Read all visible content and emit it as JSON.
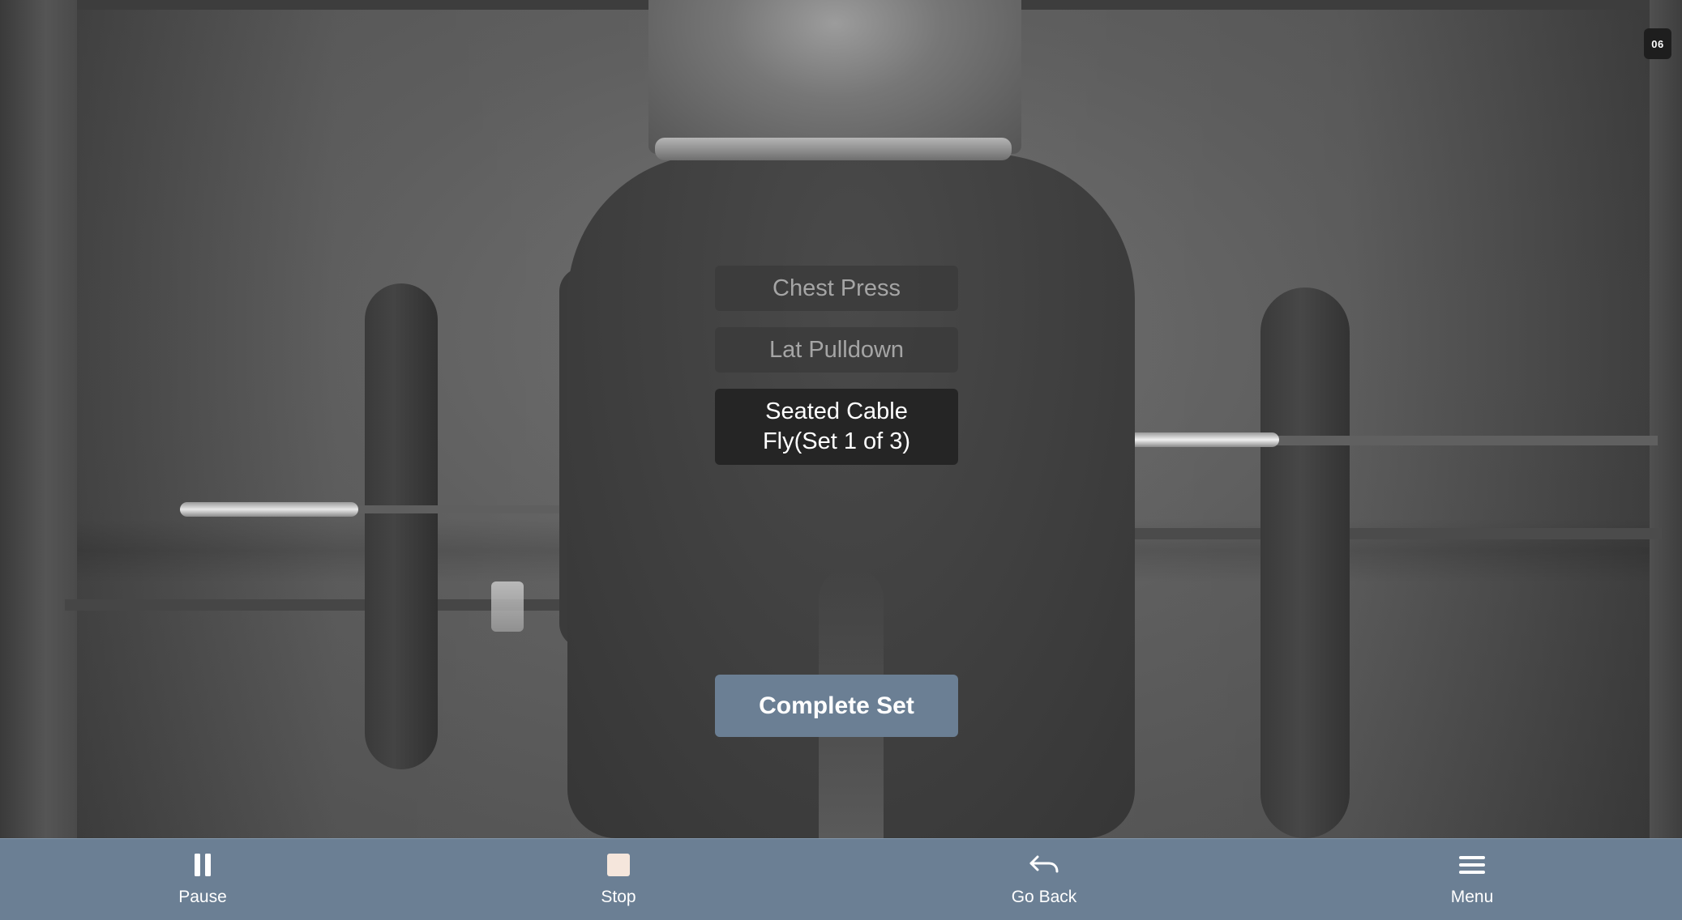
{
  "colors": {
    "accent": "#6b7f94",
    "current_item_bg": "#252525",
    "upcoming_item_bg": "#3a3a3a",
    "upcoming_text": "#a5a5a5",
    "stop_icon": "#f5e6dc"
  },
  "corner_badge": {
    "text": "06"
  },
  "exercises": {
    "items": [
      {
        "label": "Chest Press",
        "state": "upcoming"
      },
      {
        "label": "Lat Pulldown",
        "state": "upcoming"
      },
      {
        "label": "Seated Cable Fly(Set 1 of 3)",
        "state": "current"
      }
    ]
  },
  "actions": {
    "complete_set_label": "Complete Set"
  },
  "bottom_nav": {
    "pause": {
      "label": "Pause",
      "icon": "pause-icon"
    },
    "stop": {
      "label": "Stop",
      "icon": "stop-icon"
    },
    "go_back": {
      "label": "Go Back",
      "icon": "return-arrow-icon"
    },
    "menu": {
      "label": "Menu",
      "icon": "hamburger-menu-icon"
    }
  }
}
